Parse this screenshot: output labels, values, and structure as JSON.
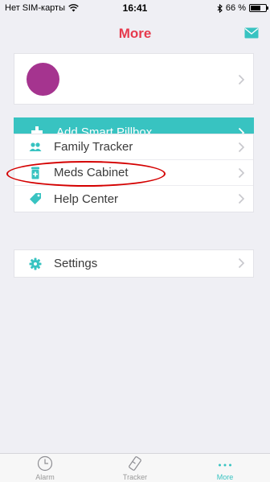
{
  "status_bar": {
    "carrier": "Нет SIM-карты",
    "time": "16:41",
    "battery_text": "66 %",
    "battery_level": 0.66
  },
  "nav": {
    "title": "More",
    "mail_icon": "mail-icon"
  },
  "profile": {
    "avatar_color": "#a5348f"
  },
  "add_pillbox": {
    "label": "Add Smart Pillbox",
    "color": "#38c3c1"
  },
  "menu_group_1": [
    {
      "label": "Family Tracker",
      "icon": "family-icon"
    },
    {
      "label": "Meds Cabinet",
      "icon": "meds-cabinet-icon"
    },
    {
      "label": "Help Center",
      "icon": "tag-icon"
    }
  ],
  "menu_group_2": [
    {
      "label": "Settings",
      "icon": "gear-icon"
    }
  ],
  "tabs": [
    {
      "label": "Alarm",
      "icon": "clock-icon",
      "active": false
    },
    {
      "label": "Tracker",
      "icon": "pillbox-icon",
      "active": false
    },
    {
      "label": "More",
      "icon": "more-dots-icon",
      "active": true
    }
  ],
  "colors": {
    "accent": "#38c3c1",
    "title": "#e63a4d",
    "annotation": "#d40000"
  }
}
